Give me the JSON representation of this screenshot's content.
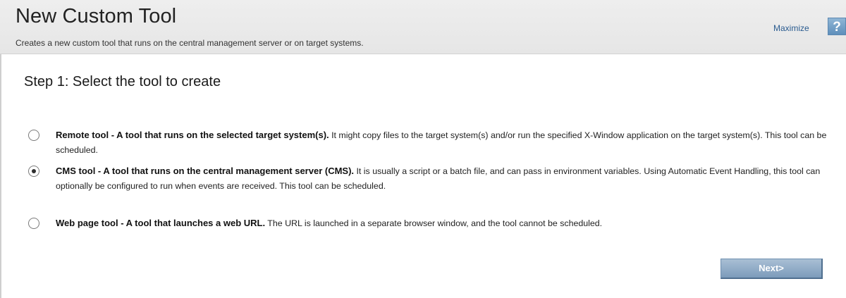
{
  "header": {
    "title": "New Custom Tool",
    "subtitle": "Creates a new custom tool that runs on the central management server or on target systems.",
    "maximize_label": "Maximize",
    "help_label": "?"
  },
  "step": {
    "title": "Step 1: Select the tool to create"
  },
  "options": [
    {
      "bold": "Remote tool - A tool that runs on the selected target system(s).",
      "text": " It might copy files to the target system(s) and/or run the specified X-Window application on the target system(s). This tool can be scheduled.",
      "selected": false
    },
    {
      "bold": "CMS tool - A tool that runs on the central management server (CMS).",
      "text": " It is usually a script or a batch file, and can pass in environment variables. Using Automatic Event Handling, this tool can optionally be configured to run when events are received. This tool can be scheduled.",
      "selected": true
    },
    {
      "bold": "Web page tool - A tool that launches a web URL.",
      "text": " The URL is launched in a separate browser window, and the tool cannot be scheduled.",
      "selected": false
    }
  ],
  "footer": {
    "next_label": "Next>"
  }
}
